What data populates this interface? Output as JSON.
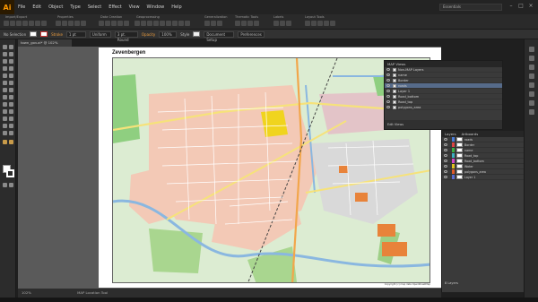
{
  "app": {
    "logo": "Ai",
    "workspace": "Essentials"
  },
  "menu": [
    "File",
    "Edit",
    "Object",
    "Type",
    "Select",
    "Effect",
    "View",
    "Window",
    "Help"
  ],
  "toolbar_groups": [
    "Import/Export",
    "Properties",
    "Data Creation",
    "Geoprocessing",
    "Generalization",
    "Thematic Tools",
    "Labels",
    "Layout Tools"
  ],
  "control_bar": {
    "selection": "No Selection",
    "stroke_label": "Stroke",
    "stroke_value": "1 pt",
    "stroke_profile": "Uniform",
    "brush_value": "3 pt. Round",
    "opacity_label": "Opacity",
    "opacity_value": "100%",
    "style_label": "Style",
    "doc_setup": "Document Setup",
    "preferences": "Preferences"
  },
  "document_tab": "town_gov.ai* @ 102% (RGB/Preview)",
  "map": {
    "title": "Zevenbergen",
    "credit": "Copyright (c) map data OpenStreetMap"
  },
  "mapviews": {
    "title": "MAP Views",
    "root": "Non-MAP Layers",
    "rows": [
      "name",
      "Border",
      "roads",
      "Layer 1",
      "Road_bottom",
      "Road_top",
      "polygons_area",
      "Water"
    ],
    "selected_index": 2,
    "footer": "Edit Views"
  },
  "layers": {
    "tabs": [
      "Layers",
      "Artboards"
    ],
    "rows": [
      {
        "name": "roads",
        "color": "#4a7bd6"
      },
      {
        "name": "Border",
        "color": "#d44"
      },
      {
        "name": "name",
        "color": "#3cb043"
      },
      {
        "name": "Road_top",
        "color": "#3cb0c0"
      },
      {
        "name": "Road_bottom",
        "color": "#d447c8"
      },
      {
        "name": "Water",
        "color": "#e0c020"
      },
      {
        "name": "polygons_area",
        "color": "#e05a2a"
      },
      {
        "name": "Layer 1",
        "color": "#5a6bd0"
      }
    ],
    "count": "8 Layers"
  },
  "status_bar": {
    "zoom": "102%",
    "tool": "MAP Location Tool"
  }
}
